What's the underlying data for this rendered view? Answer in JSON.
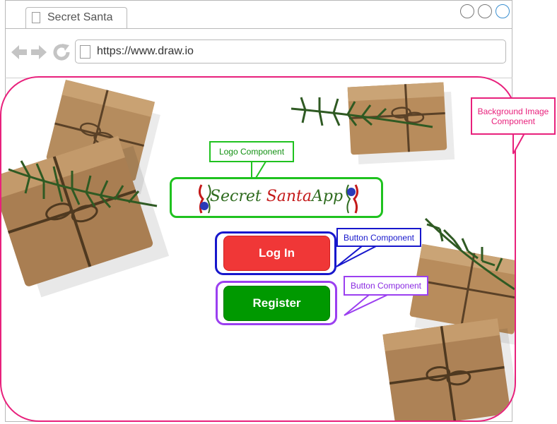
{
  "browser": {
    "tab_title": "Secret Santa",
    "url": "https://www.draw.io"
  },
  "logo": {
    "word1": "Secret",
    "word2": "Santa",
    "word3": "App"
  },
  "buttons": {
    "login_label": "Log In",
    "register_label": "Register"
  },
  "callouts": {
    "background": "Background Image Component",
    "logo": "Logo Component",
    "login_button": "Button Component",
    "register_button": "Button Component"
  },
  "colors": {
    "background_component": "#e8217c",
    "logo_component": "#1fc21f",
    "login_component": "#1717cc",
    "register_component": "#9b3ff0",
    "login_button": "#f03737",
    "register_button": "#009900"
  },
  "icons": [
    "page-icon",
    "back-arrow-icon",
    "forward-arrow-icon",
    "reload-icon",
    "window-control-icon",
    "gift-box-icon",
    "evergreen-sprig-icon"
  ]
}
